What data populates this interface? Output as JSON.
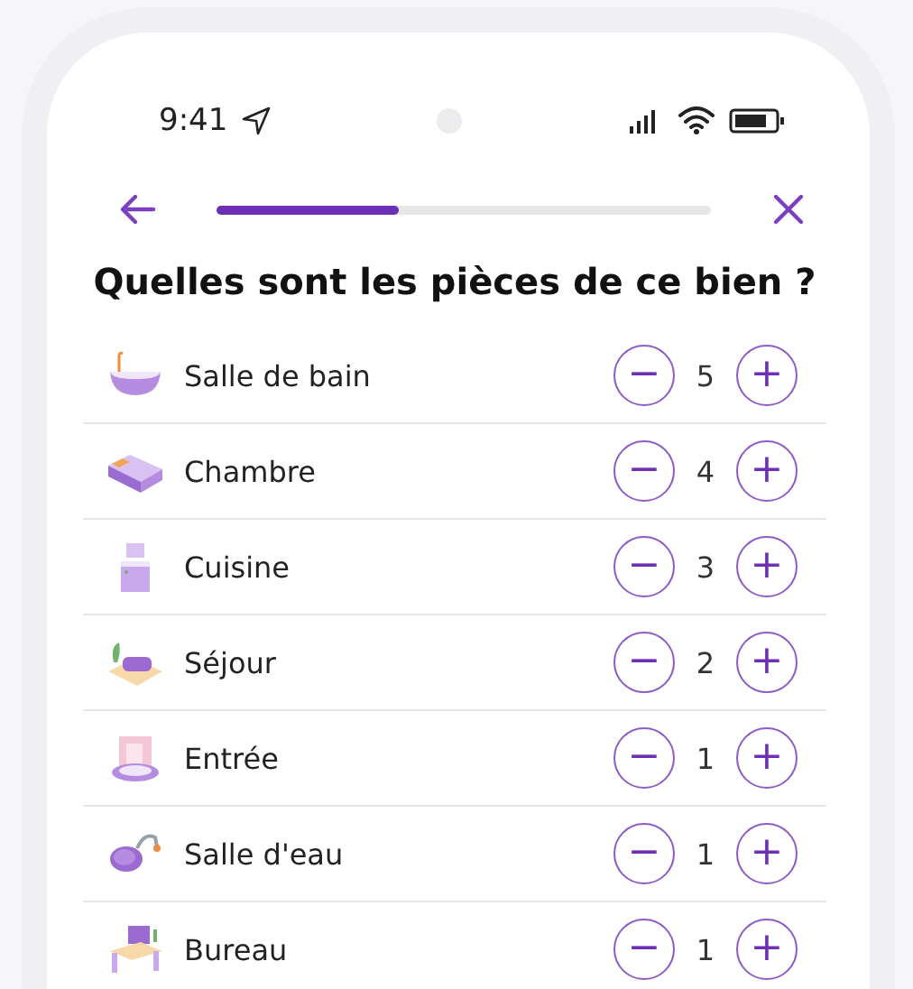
{
  "status_bar": {
    "time": "9:41"
  },
  "nav": {
    "progress": {
      "level": 0.37
    }
  },
  "title": "Quelles sont les pièces de ce bien ?",
  "rooms": [
    {
      "kind": "bath",
      "name": "Salle de bain",
      "count": "5",
      "minus": "−",
      "plus": "+"
    },
    {
      "kind": "bed",
      "name": "Chambre",
      "count": "4",
      "minus": "−",
      "plus": "+"
    },
    {
      "kind": "kitchen",
      "name": "Cuisine",
      "count": "3",
      "minus": "−",
      "plus": "+"
    },
    {
      "kind": "living",
      "name": "Séjour",
      "count": "2",
      "minus": "−",
      "plus": "+"
    },
    {
      "kind": "entry",
      "name": "Entrée",
      "count": "1",
      "minus": "−",
      "plus": "+"
    },
    {
      "kind": "shower",
      "name": "Salle d'eau",
      "count": "1",
      "minus": "−",
      "plus": "+"
    },
    {
      "kind": "desk",
      "name": "Bureau",
      "count": "1",
      "minus": "−",
      "plus": "+"
    }
  ]
}
